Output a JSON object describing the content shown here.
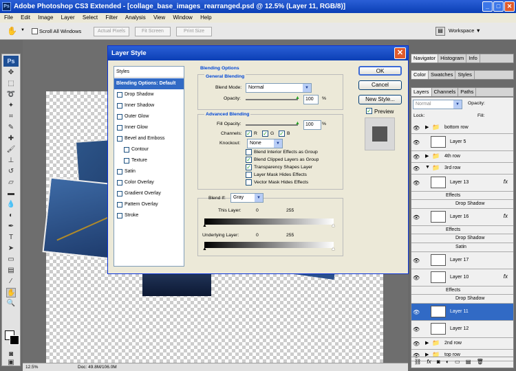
{
  "window": {
    "title": "Adobe Photoshop CS3 Extended - [collage_base_images_rearranged.psd @ 12.5% (Layer 11, RGB/8)]",
    "app_icon": "Ps"
  },
  "menu": [
    "File",
    "Edit",
    "Image",
    "Layer",
    "Select",
    "Filter",
    "Analysis",
    "View",
    "Window",
    "Help"
  ],
  "options_bar": {
    "scroll_all_label": "Scroll All Windows",
    "actual_pixels": "Actual Pixels",
    "fit_screen": "Fit Screen",
    "print_size": "Print Size",
    "workspace": "Workspace ▼"
  },
  "status": {
    "zoom": "12.5%",
    "doc": "Doc: 49.8M/106.0M"
  },
  "dialog": {
    "title": "Layer Style",
    "styles_header": "Styles",
    "styles": [
      {
        "label": "Blending Options: Default",
        "selected": true,
        "checkbox": false
      },
      {
        "label": "Drop Shadow",
        "checkbox": true
      },
      {
        "label": "Inner Shadow",
        "checkbox": true
      },
      {
        "label": "Outer Glow",
        "checkbox": true
      },
      {
        "label": "Inner Glow",
        "checkbox": true
      },
      {
        "label": "Bevel and Emboss",
        "checkbox": true
      },
      {
        "label": "Contour",
        "checkbox": true,
        "indent": true
      },
      {
        "label": "Texture",
        "checkbox": true,
        "indent": true
      },
      {
        "label": "Satin",
        "checkbox": true
      },
      {
        "label": "Color Overlay",
        "checkbox": true
      },
      {
        "label": "Gradient Overlay",
        "checkbox": true
      },
      {
        "label": "Pattern Overlay",
        "checkbox": true
      },
      {
        "label": "Stroke",
        "checkbox": true
      }
    ],
    "blending_options_title": "Blending Options",
    "general_blending": "General Blending",
    "blend_mode_label": "Blend Mode:",
    "blend_mode_value": "Normal",
    "opacity_label": "Opacity:",
    "opacity_value": "100",
    "percent": "%",
    "advanced_blending": "Advanced Blending",
    "fill_opacity_label": "Fill Opacity:",
    "fill_opacity_value": "100",
    "channels_label": "Channels:",
    "channel_r": "R",
    "channel_g": "G",
    "channel_b": "B",
    "knockout_label": "Knockout:",
    "knockout_value": "None",
    "advanced_checks": [
      {
        "label": "Blend Interior Effects as Group",
        "checked": false
      },
      {
        "label": "Blend Clipped Layers as Group",
        "checked": true
      },
      {
        "label": "Transparency Shapes Layer",
        "checked": true
      },
      {
        "label": "Layer Mask Hides Effects",
        "checked": false
      },
      {
        "label": "Vector Mask Hides Effects",
        "checked": false
      }
    ],
    "blend_if_label": "Blend If:",
    "blend_if_value": "Gray",
    "this_layer_label": "This Layer:",
    "underlying_label": "Underlying Layer:",
    "range_min": "0",
    "range_max": "255",
    "ok": "OK",
    "cancel": "Cancel",
    "new_style": "New Style...",
    "preview_label": "Preview"
  },
  "panels": {
    "group1": [
      "Navigator",
      "Histogram",
      "Info"
    ],
    "group2": [
      "Color",
      "Swatches",
      "Styles"
    ],
    "group3": [
      "Layers",
      "Channels",
      "Paths"
    ],
    "blend_mode": "Normal",
    "opacity_label": "Opacity:",
    "lock_label": "Lock:",
    "fill_label": "Fill:",
    "fx_label": "fx",
    "layers": [
      {
        "name": "bottom row",
        "type": "folder"
      },
      {
        "name": "Layer 5",
        "type": "layer"
      },
      {
        "name": "4th row",
        "type": "folder"
      },
      {
        "name": "3rd row",
        "type": "folder-open"
      },
      {
        "name": "Layer 13",
        "type": "layer",
        "fx": true
      },
      {
        "name": "Effects",
        "type": "effects"
      },
      {
        "name": "Drop Shadow",
        "type": "effect"
      },
      {
        "name": "Layer 16",
        "type": "layer",
        "fx": true
      },
      {
        "name": "Effects",
        "type": "effects"
      },
      {
        "name": "Drop Shadow",
        "type": "effect"
      },
      {
        "name": "Satin",
        "type": "effect"
      },
      {
        "name": "Layer 17",
        "type": "layer"
      },
      {
        "name": "Layer 10",
        "type": "layer",
        "fx": true
      },
      {
        "name": "Effects",
        "type": "effects"
      },
      {
        "name": "Drop Shadow",
        "type": "effect"
      },
      {
        "name": "Layer 11",
        "type": "layer",
        "selected": true
      },
      {
        "name": "Layer 12",
        "type": "layer"
      },
      {
        "name": "2nd row",
        "type": "folder"
      },
      {
        "name": "top row",
        "type": "folder"
      }
    ]
  }
}
